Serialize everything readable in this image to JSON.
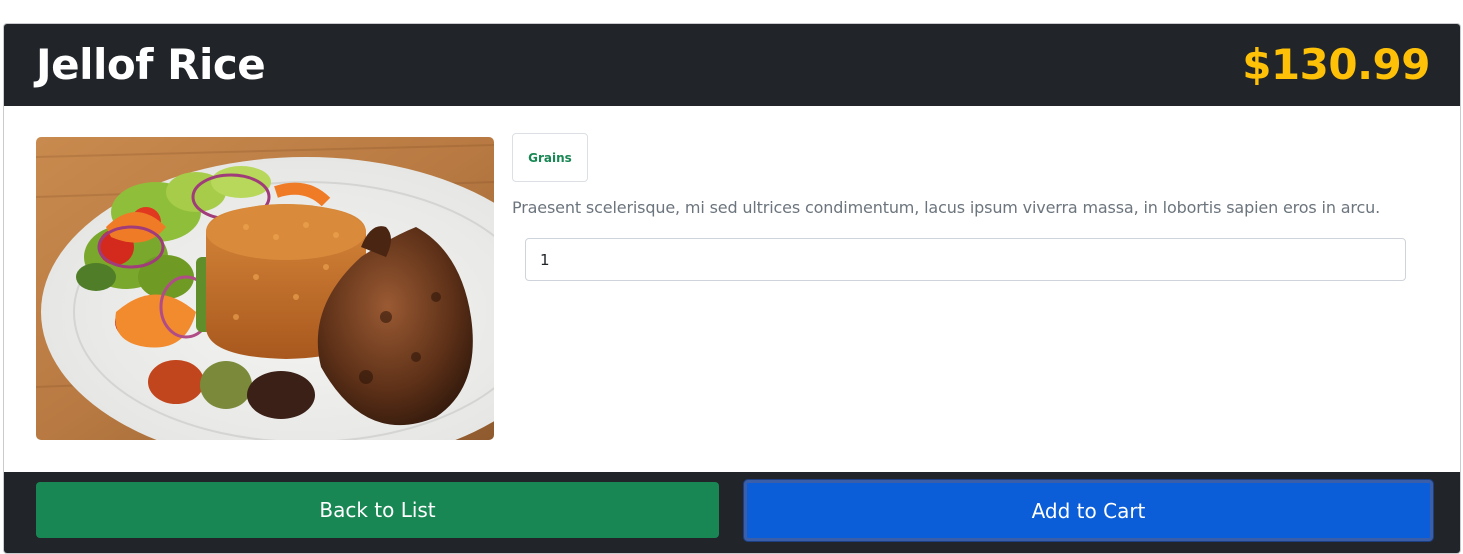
{
  "product": {
    "name": "Jellof Rice",
    "price": "$130.99",
    "category": "Grains",
    "description": "Praesent scelerisque, mi sed ultrices condimentum, lacus ipsum viverra massa, in lobortis sapien eros in arcu.",
    "image_subject": "jollof-rice-plate-photo"
  },
  "quantity": {
    "value": "1"
  },
  "actions": {
    "back_label": "Back to List",
    "add_label": "Add to Cart"
  },
  "colors": {
    "header_bg": "#212529",
    "price": "#ffc107",
    "category_text": "#198754",
    "back_button": "#198754",
    "add_button": "#0b5ed7"
  }
}
